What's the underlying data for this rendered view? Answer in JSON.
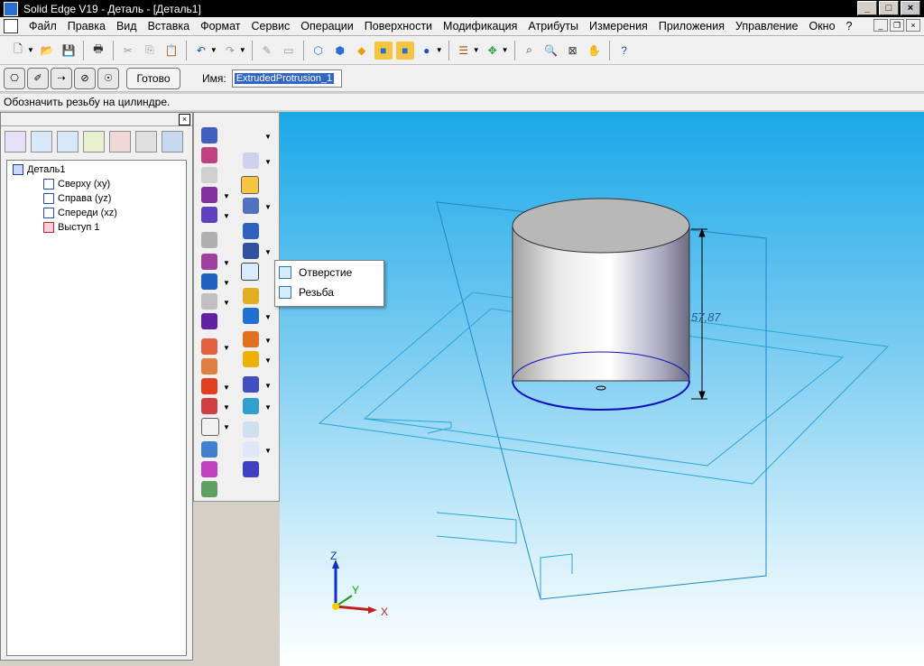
{
  "window": {
    "title": "Solid Edge V19 - Деталь - [Деталь1]"
  },
  "menu": {
    "items": [
      "Файл",
      "Правка",
      "Вид",
      "Вставка",
      "Формат",
      "Сервис",
      "Операции",
      "Поверхности",
      "Модификация",
      "Атрибуты",
      "Измерения",
      "Приложения",
      "Управление",
      "Окно",
      "?"
    ]
  },
  "toolbar2": {
    "done_label": "Готово",
    "name_label": "Имя:",
    "name_value": "ExtrudedProtrusion_1"
  },
  "prompt": {
    "text": "Обозначить резьбу на цилиндре."
  },
  "tree": {
    "root": "Деталь1",
    "items": [
      "Сверху (xy)",
      "Справа (yz)",
      "Спереди (xz)",
      "Выступ 1"
    ]
  },
  "popup": {
    "items": [
      "Отверстие",
      "Резьба"
    ]
  },
  "viewport": {
    "dimension": "57,87",
    "axis_x": "X",
    "axis_y": "Y",
    "axis_z": "Z"
  }
}
